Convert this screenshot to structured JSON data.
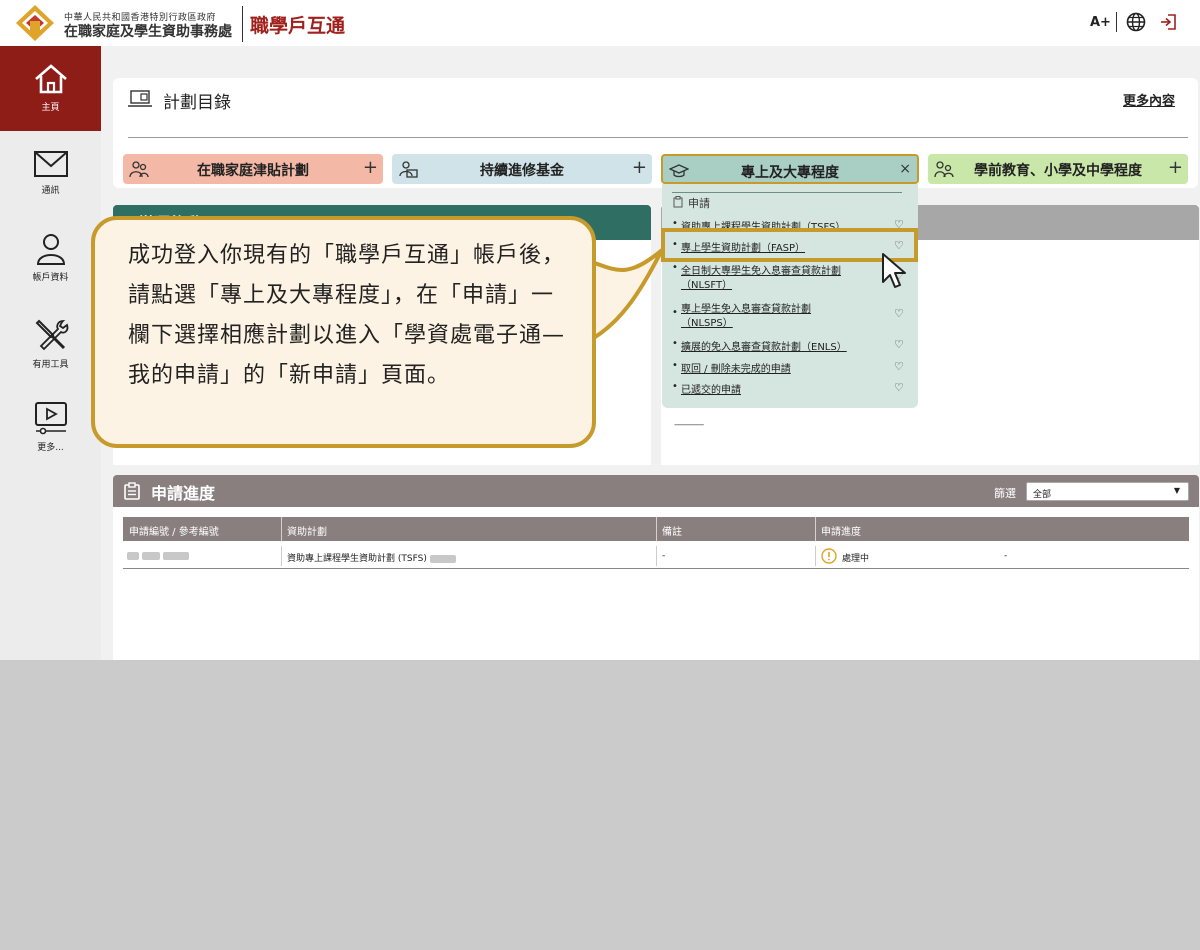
{
  "header": {
    "org_small": "中華人民共和國香港特別行政區政府",
    "org_name": "在職家庭及學生資助事務處",
    "brand": "職學戶互通",
    "font_size_label": "A+",
    "icons": [
      "logo-icon",
      "globe-icon",
      "logout-icon"
    ]
  },
  "sidebar": {
    "items": [
      {
        "label": "主頁",
        "icon": "home-icon",
        "active": true
      },
      {
        "label": "通訊",
        "icon": "mail-icon"
      },
      {
        "label": "帳戶資料",
        "icon": "user-icon"
      },
      {
        "label": "有用工具",
        "icon": "tools-icon"
      },
      {
        "label": "更多...",
        "icon": "video-icon"
      }
    ]
  },
  "plans": {
    "title": "計劃目錄",
    "more": "更多內容",
    "tabs": [
      {
        "label": "在職家庭津貼計劃",
        "action": "+"
      },
      {
        "label": "持續進修基金",
        "action": "+"
      },
      {
        "label": "專上及大專程度",
        "action": "×"
      },
      {
        "label": "學前教育、小學及中學程度",
        "action": "+"
      }
    ]
  },
  "left_panel": {
    "title": "變遷後動"
  },
  "dropdown": {
    "header": "申請",
    "items": [
      {
        "line1": "資助專上課程學生資助計劃（TSFS）"
      },
      {
        "line1": "專上學生資助計劃（FASP）"
      },
      {
        "line1": "全日制大專學生免入息審查貸款計劃",
        "line2": "（NLSFT）"
      },
      {
        "line1": "專上學生免入息審查貸款計劃",
        "line2": "（NLSPS）"
      },
      {
        "line1": "擴展的免入息審查貸款計劃（ENLS）"
      },
      {
        "line1": "取回 / 刪除未完成的申請"
      },
      {
        "line1": "已遞交的申請"
      }
    ],
    "footer": "-------------"
  },
  "callout": {
    "text": "成功登入你現有的「職學戶互通」帳戶後，請點選「專上及大專程度」，在「申請」一欄下選擇相應計劃以進入「學資處電子通—我的申請」的「新申請」頁面。"
  },
  "progress": {
    "title": "申請進度",
    "filter_label": "篩選",
    "filter_value": "全部",
    "columns": [
      "申請編號 / 參考編號",
      "資助計劃",
      "備註",
      "申請進度"
    ],
    "rows": [
      {
        "scheme": "資助專上課程學生資助計劃 (TSFS)",
        "remark": "-",
        "status": "處理中",
        "extra": "-"
      }
    ]
  },
  "colors": {
    "brand_red": "#8e1d18",
    "highlight": "#c79a2c",
    "tab1": "#f4b8a6",
    "tab2": "#cfe3e8",
    "tab3": "#a9cfc4",
    "tab4": "#c9e7a8"
  }
}
